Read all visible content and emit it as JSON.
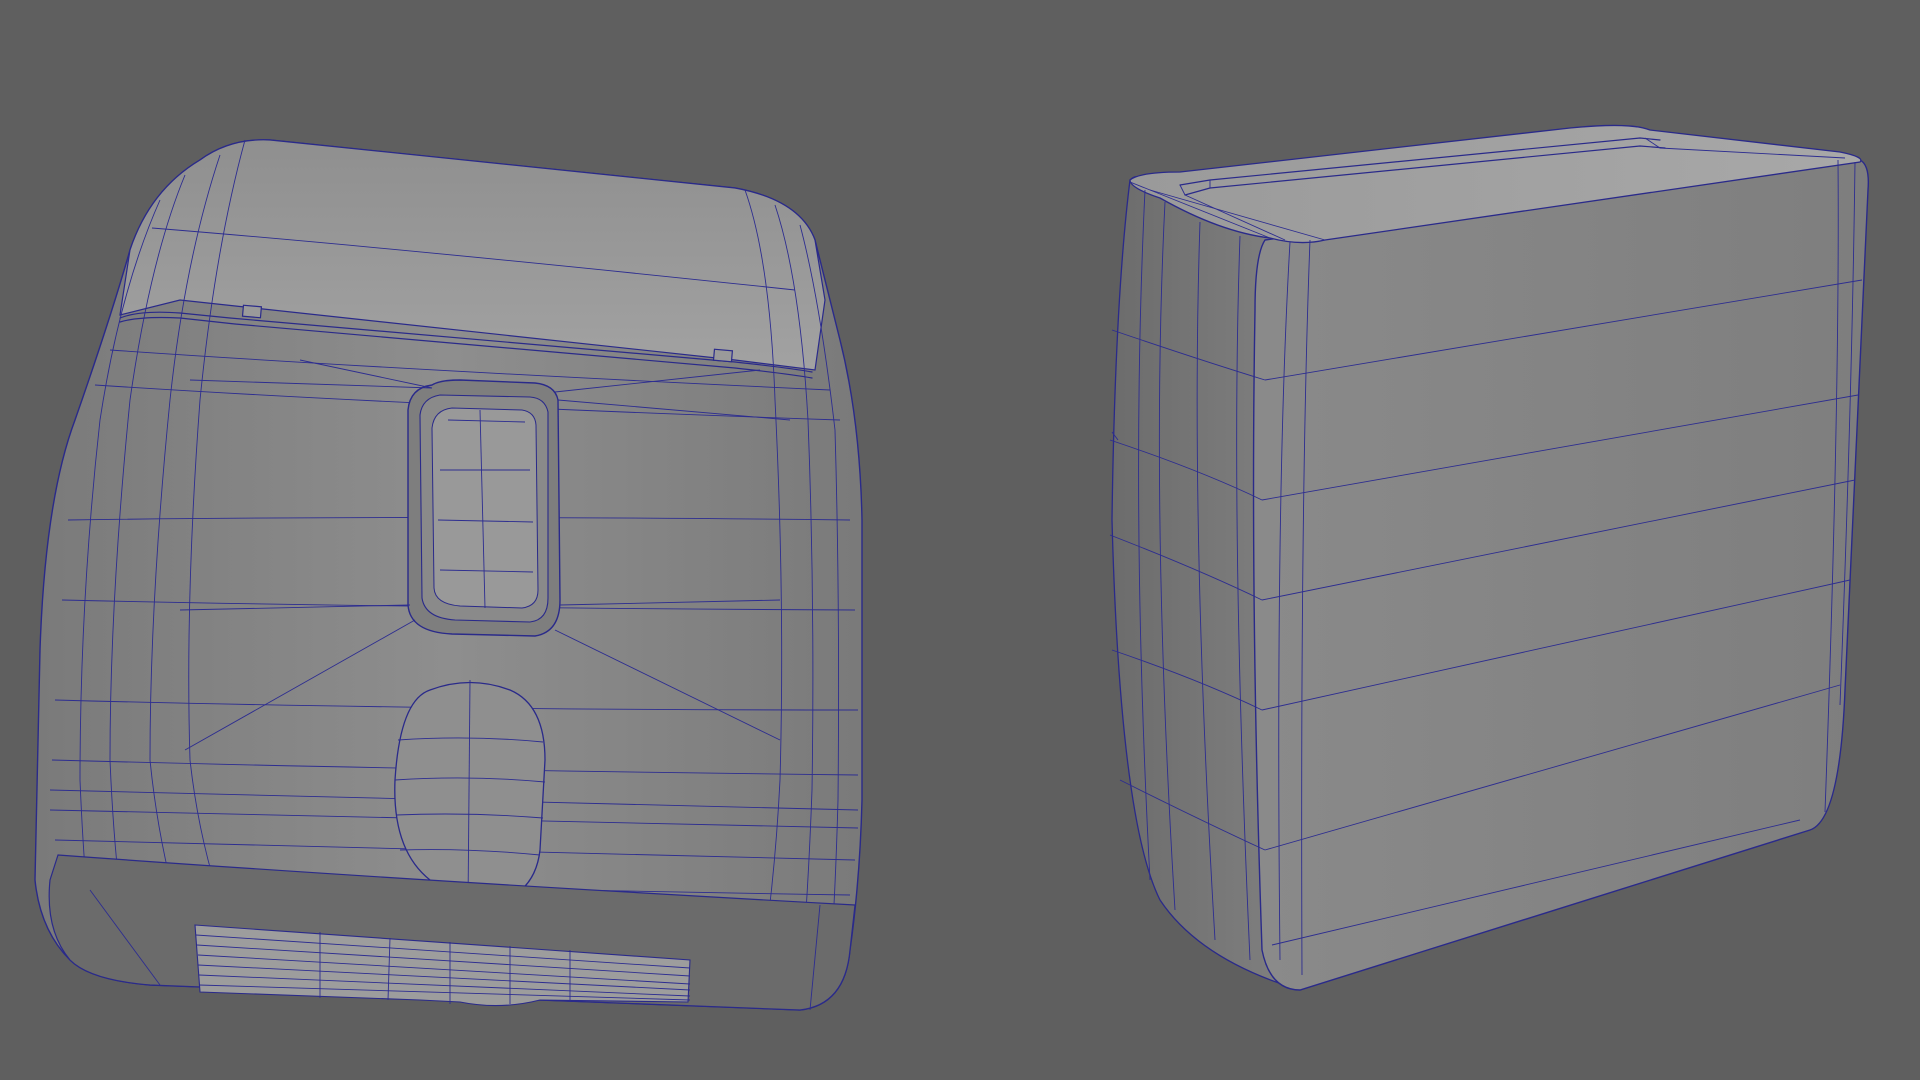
{
  "viewport": {
    "background": "#5f5f5f",
    "wireframe_color": "#2a2a8a"
  },
  "objects": [
    {
      "id": "left",
      "view": "front",
      "description_icon": "mesh-icon"
    },
    {
      "id": "right",
      "view": "three-quarter",
      "description_icon": "mesh-icon"
    }
  ]
}
